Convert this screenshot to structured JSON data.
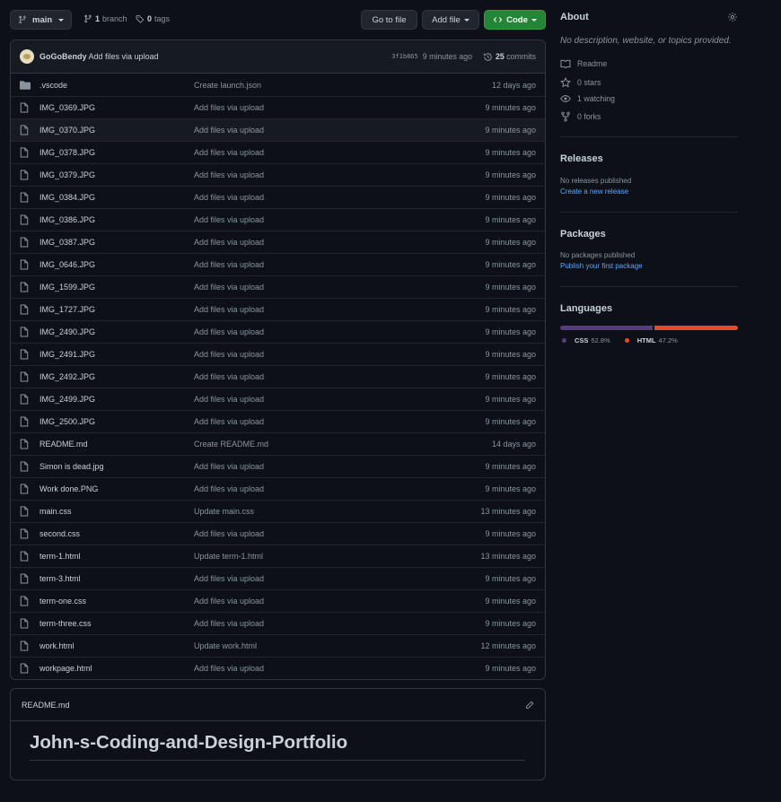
{
  "toolbar": {
    "branch_label": "main",
    "branches_count": "1",
    "branches_label": "branch",
    "tags_count": "0",
    "tags_label": "tags",
    "go_to_file": "Go to file",
    "add_file": "Add file",
    "code": "Code"
  },
  "commit": {
    "author": "GoGoBendy",
    "message": "Add files via upload",
    "sha": "3f1b865",
    "age": "9 minutes ago",
    "commits_count": "25",
    "commits_label": "commits"
  },
  "files": [
    {
      "name": ".vscode",
      "type": "folder",
      "message": "Create launch.json",
      "age": "12 days ago"
    },
    {
      "name": "IMG_0369.JPG",
      "type": "file",
      "message": "Add files via upload",
      "age": "9 minutes ago"
    },
    {
      "name": "IMG_0370.JPG",
      "type": "file",
      "message": "Add files via upload",
      "age": "9 minutes ago"
    },
    {
      "name": "IMG_0378.JPG",
      "type": "file",
      "message": "Add files via upload",
      "age": "9 minutes ago"
    },
    {
      "name": "IMG_0379.JPG",
      "type": "file",
      "message": "Add files via upload",
      "age": "9 minutes ago"
    },
    {
      "name": "IMG_0384.JPG",
      "type": "file",
      "message": "Add files via upload",
      "age": "9 minutes ago"
    },
    {
      "name": "IMG_0386.JPG",
      "type": "file",
      "message": "Add files via upload",
      "age": "9 minutes ago"
    },
    {
      "name": "IMG_0387.JPG",
      "type": "file",
      "message": "Add files via upload",
      "age": "9 minutes ago"
    },
    {
      "name": "IMG_0646.JPG",
      "type": "file",
      "message": "Add files via upload",
      "age": "9 minutes ago"
    },
    {
      "name": "IMG_1599.JPG",
      "type": "file",
      "message": "Add files via upload",
      "age": "9 minutes ago"
    },
    {
      "name": "IMG_1727.JPG",
      "type": "file",
      "message": "Add files via upload",
      "age": "9 minutes ago"
    },
    {
      "name": "IMG_2490.JPG",
      "type": "file",
      "message": "Add files via upload",
      "age": "9 minutes ago"
    },
    {
      "name": "IMG_2491.JPG",
      "type": "file",
      "message": "Add files via upload",
      "age": "9 minutes ago"
    },
    {
      "name": "IMG_2492.JPG",
      "type": "file",
      "message": "Add files via upload",
      "age": "9 minutes ago"
    },
    {
      "name": "IMG_2499.JPG",
      "type": "file",
      "message": "Add files via upload",
      "age": "9 minutes ago"
    },
    {
      "name": "IMG_2500.JPG",
      "type": "file",
      "message": "Add files via upload",
      "age": "9 minutes ago"
    },
    {
      "name": "README.md",
      "type": "file",
      "message": "Create README.md",
      "age": "14 days ago"
    },
    {
      "name": "Simon is dead.jpg",
      "type": "file",
      "message": "Add files via upload",
      "age": "9 minutes ago"
    },
    {
      "name": "Work done.PNG",
      "type": "file",
      "message": "Add files via upload",
      "age": "9 minutes ago"
    },
    {
      "name": "main.css",
      "type": "file",
      "message": "Update main.css",
      "age": "13 minutes ago"
    },
    {
      "name": "second.css",
      "type": "file",
      "message": "Add files via upload",
      "age": "9 minutes ago"
    },
    {
      "name": "term-1.html",
      "type": "file",
      "message": "Update term-1.html",
      "age": "13 minutes ago"
    },
    {
      "name": "term-3.html",
      "type": "file",
      "message": "Add files via upload",
      "age": "9 minutes ago"
    },
    {
      "name": "term-one.css",
      "type": "file",
      "message": "Add files via upload",
      "age": "9 minutes ago"
    },
    {
      "name": "term-three.css",
      "type": "file",
      "message": "Add files via upload",
      "age": "9 minutes ago"
    },
    {
      "name": "work.html",
      "type": "file",
      "message": "Update work.html",
      "age": "12 minutes ago"
    },
    {
      "name": "workpage.html",
      "type": "file",
      "message": "Add files via upload",
      "age": "9 minutes ago"
    }
  ],
  "readme": {
    "filename": "README.md",
    "title": "John-s-Coding-and-Design-Portfolio"
  },
  "about": {
    "heading": "About",
    "description": "No description, website, or topics provided.",
    "readme": "Readme",
    "stars": "0 stars",
    "watching": "1 watching",
    "forks": "0 forks"
  },
  "releases": {
    "heading": "Releases",
    "empty": "No releases published",
    "link": "Create a new release"
  },
  "packages": {
    "heading": "Packages",
    "empty": "No packages published",
    "link": "Publish your first package"
  },
  "languages": {
    "heading": "Languages",
    "items": [
      {
        "name": "CSS",
        "percent": "52.8%",
        "value": 52.8,
        "color": "#563d7c"
      },
      {
        "name": "HTML",
        "percent": "47.2%",
        "value": 47.2,
        "color": "#e34c26"
      }
    ]
  }
}
